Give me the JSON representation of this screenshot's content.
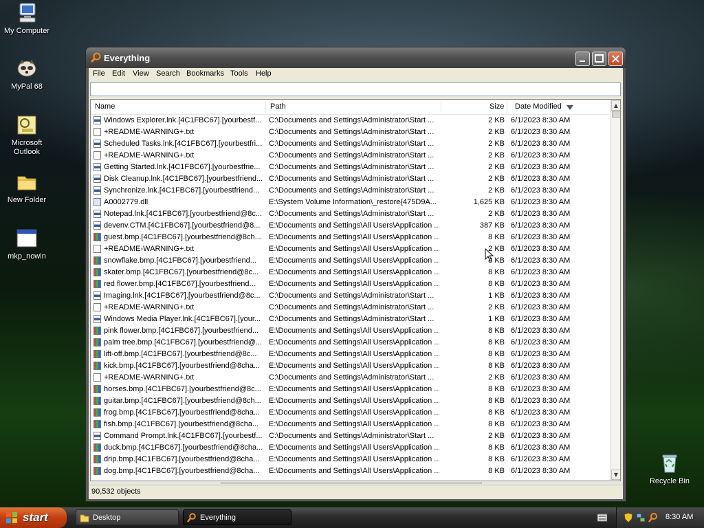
{
  "desktop": {
    "icons": [
      {
        "label": "My Computer",
        "icon": "computer-icon"
      },
      {
        "label": "MyPal 68",
        "icon": "raccoon-browser-icon"
      },
      {
        "label": "Microsoft Outlook",
        "icon": "outlook-icon"
      },
      {
        "label": "New Folder",
        "icon": "folder-icon"
      },
      {
        "label": "mkp_nowin",
        "icon": "window-app-icon"
      },
      {
        "label": "Recycle Bin",
        "icon": "recycle-bin-icon"
      }
    ]
  },
  "window": {
    "title": "Everything",
    "menu": [
      "File",
      "Edit",
      "View",
      "Search",
      "Bookmarks",
      "Tools",
      "Help"
    ],
    "search_value": "",
    "columns": {
      "name": "Name",
      "path": "Path",
      "size": "Size",
      "date": "Date Modified"
    },
    "sort_column": "Date Modified",
    "rows": [
      {
        "icon": "lnk",
        "name": "Windows Explorer.lnk.[4C1FBC67].[yourbestf...",
        "path": "C:\\Documents and Settings\\Administrator\\Start ...",
        "size": "2 KB",
        "date": "6/1/2023 8:30 AM"
      },
      {
        "icon": "txt",
        "name": "+README-WARNING+.txt",
        "path": "C:\\Documents and Settings\\Administrator\\Start ...",
        "size": "2 KB",
        "date": "6/1/2023 8:30 AM"
      },
      {
        "icon": "lnk",
        "name": "Scheduled Tasks.lnk.[4C1FBC67].[yourbestfri...",
        "path": "C:\\Documents and Settings\\Administrator\\Start ...",
        "size": "2 KB",
        "date": "6/1/2023 8:30 AM"
      },
      {
        "icon": "txt",
        "name": "+README-WARNING+.txt",
        "path": "C:\\Documents and Settings\\Administrator\\Start ...",
        "size": "2 KB",
        "date": "6/1/2023 8:30 AM"
      },
      {
        "icon": "lnk",
        "name": "Getting Started.lnk.[4C1FBC67].[yourbestfrie...",
        "path": "C:\\Documents and Settings\\Administrator\\Start ...",
        "size": "2 KB",
        "date": "6/1/2023 8:30 AM"
      },
      {
        "icon": "lnk",
        "name": "Disk Cleanup.lnk.[4C1FBC67].[yourbestfriend...",
        "path": "C:\\Documents and Settings\\Administrator\\Start ...",
        "size": "2 KB",
        "date": "6/1/2023 8:30 AM"
      },
      {
        "icon": "lnk",
        "name": "Synchronize.lnk.[4C1FBC67].[yourbestfriend...",
        "path": "C:\\Documents and Settings\\Administrator\\Start ...",
        "size": "2 KB",
        "date": "6/1/2023 8:30 AM"
      },
      {
        "icon": "dll",
        "name": "A0002779.dll",
        "path": "E:\\System Volume Information\\_restore{475D9A...",
        "size": "1,625 KB",
        "date": "6/1/2023 8:30 AM"
      },
      {
        "icon": "lnk",
        "name": "Notepad.lnk.[4C1FBC67].[yourbestfriend@8c...",
        "path": "C:\\Documents and Settings\\Administrator\\Start ...",
        "size": "2 KB",
        "date": "6/1/2023 8:30 AM"
      },
      {
        "icon": "lnk",
        "name": "devenv.CTM.[4C1FBC67].[yourbestfriend@8...",
        "path": "E:\\Documents and Settings\\All Users\\Application ...",
        "size": "387 KB",
        "date": "6/1/2023 8:30 AM"
      },
      {
        "icon": "bmp",
        "name": "guest.bmp.[4C1FBC67].[yourbestfriend@8ch...",
        "path": "E:\\Documents and Settings\\All Users\\Application ...",
        "size": "8 KB",
        "date": "6/1/2023 8:30 AM"
      },
      {
        "icon": "txt",
        "name": "+README-WARNING+.txt",
        "path": "E:\\Documents and Settings\\All Users\\Application ...",
        "size": "2 KB",
        "date": "6/1/2023 8:30 AM"
      },
      {
        "icon": "bmp",
        "name": "snowflake.bmp.[4C1FBC67].[yourbestfriend...",
        "path": "E:\\Documents and Settings\\All Users\\Application ...",
        "size": "8 KB",
        "date": "6/1/2023 8:30 AM"
      },
      {
        "icon": "bmp",
        "name": "skater.bmp.[4C1FBC67].[yourbestfriend@8c...",
        "path": "E:\\Documents and Settings\\All Users\\Application ...",
        "size": "8 KB",
        "date": "6/1/2023 8:30 AM"
      },
      {
        "icon": "bmp",
        "name": "red flower.bmp.[4C1FBC67].[yourbestfriend...",
        "path": "E:\\Documents and Settings\\All Users\\Application ...",
        "size": "8 KB",
        "date": "6/1/2023 8:30 AM"
      },
      {
        "icon": "lnk",
        "name": "Imaging.lnk.[4C1FBC67].[yourbestfriend@8c...",
        "path": "C:\\Documents and Settings\\Administrator\\Start ...",
        "size": "1 KB",
        "date": "6/1/2023 8:30 AM"
      },
      {
        "icon": "txt",
        "name": "+README-WARNING+.txt",
        "path": "C:\\Documents and Settings\\Administrator\\Start ...",
        "size": "2 KB",
        "date": "6/1/2023 8:30 AM"
      },
      {
        "icon": "lnk",
        "name": "Windows Media Player.lnk.[4C1FBC67].[your...",
        "path": "C:\\Documents and Settings\\Administrator\\Start ...",
        "size": "1 KB",
        "date": "6/1/2023 8:30 AM"
      },
      {
        "icon": "bmp",
        "name": "pink flower.bmp.[4C1FBC67].[yourbestfriend...",
        "path": "E:\\Documents and Settings\\All Users\\Application ...",
        "size": "8 KB",
        "date": "6/1/2023 8:30 AM"
      },
      {
        "icon": "bmp",
        "name": "palm tree.bmp.[4C1FBC67].[yourbestfriend@...",
        "path": "E:\\Documents and Settings\\All Users\\Application ...",
        "size": "8 KB",
        "date": "6/1/2023 8:30 AM"
      },
      {
        "icon": "bmp",
        "name": "lift-off.bmp.[4C1FBC67].[yourbestfriend@8c...",
        "path": "E:\\Documents and Settings\\All Users\\Application ...",
        "size": "8 KB",
        "date": "6/1/2023 8:30 AM"
      },
      {
        "icon": "bmp",
        "name": "kick.bmp.[4C1FBC67].[yourbestfriend@8cha...",
        "path": "E:\\Documents and Settings\\All Users\\Application ...",
        "size": "8 KB",
        "date": "6/1/2023 8:30 AM"
      },
      {
        "icon": "txt",
        "name": "+README-WARNING+.txt",
        "path": "C:\\Documents and Settings\\Administrator\\Start ...",
        "size": "2 KB",
        "date": "6/1/2023 8:30 AM"
      },
      {
        "icon": "bmp",
        "name": "horses.bmp.[4C1FBC67].[yourbestfriend@8c...",
        "path": "E:\\Documents and Settings\\All Users\\Application ...",
        "size": "8 KB",
        "date": "6/1/2023 8:30 AM"
      },
      {
        "icon": "bmp",
        "name": "guitar.bmp.[4C1FBC67].[yourbestfriend@8ch...",
        "path": "E:\\Documents and Settings\\All Users\\Application ...",
        "size": "8 KB",
        "date": "6/1/2023 8:30 AM"
      },
      {
        "icon": "bmp",
        "name": "frog.bmp.[4C1FBC67].[yourbestfriend@8cha...",
        "path": "E:\\Documents and Settings\\All Users\\Application ...",
        "size": "8 KB",
        "date": "6/1/2023 8:30 AM"
      },
      {
        "icon": "bmp",
        "name": "fish.bmp.[4C1FBC67].[yourbestfriend@8cha...",
        "path": "E:\\Documents and Settings\\All Users\\Application ...",
        "size": "8 KB",
        "date": "6/1/2023 8:30 AM"
      },
      {
        "icon": "lnk",
        "name": "Command Prompt.lnk.[4C1FBC67].[yourbestf...",
        "path": "C:\\Documents and Settings\\Administrator\\Start ...",
        "size": "2 KB",
        "date": "6/1/2023 8:30 AM"
      },
      {
        "icon": "bmp",
        "name": "duck.bmp.[4C1FBC67].[yourbestfriend@8cha...",
        "path": "E:\\Documents and Settings\\All Users\\Application ...",
        "size": "8 KB",
        "date": "6/1/2023 8:30 AM"
      },
      {
        "icon": "bmp",
        "name": "drip.bmp.[4C1FBC67].[yourbestfriend@8cha...",
        "path": "E:\\Documents and Settings\\All Users\\Application ...",
        "size": "8 KB",
        "date": "6/1/2023 8:30 AM"
      },
      {
        "icon": "bmp",
        "name": "dog.bmp.[4C1FBC67].[yourbestfriend@8cha...",
        "path": "E:\\Documents and Settings\\All Users\\Application ...",
        "size": "8 KB",
        "date": "6/1/2023 8:30 AM"
      }
    ],
    "status": "90,532 objects"
  },
  "taskbar": {
    "start_label": "start",
    "tasks": [
      {
        "label": "Desktop",
        "icon": "folder-icon"
      },
      {
        "label": "Everything",
        "icon": "magnifier-icon"
      }
    ],
    "clock": "8:30 AM"
  },
  "colors": {
    "accent": "#c43f12",
    "titlebar": "#4e4e4e",
    "window_bg": "#ece9d8"
  }
}
